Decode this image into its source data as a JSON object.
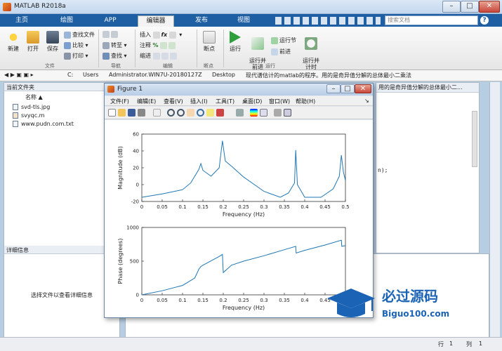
{
  "window": {
    "title": "MATLAB R2018a"
  },
  "ribbon_tabs": [
    "主页",
    "绘图",
    "APP",
    "编辑器",
    "发布",
    "视图"
  ],
  "search_placeholder": "搜索文档",
  "ribbon": {
    "new": "新建",
    "open": "打开",
    "save": "保存",
    "find_files": "查找文件",
    "compare": "比较",
    "print": "打印",
    "goto": "转至",
    "find": "查找",
    "insert": "插入",
    "comment": "注释",
    "indent": "缩进",
    "breakpoints": "断点",
    "run": "运行",
    "run_advance": "运行并\n前进",
    "run_section": "运行节",
    "advance": "前进",
    "run_time": "运行并\n计时",
    "groups": [
      "文件",
      "导航",
      "编辑",
      "断点",
      "运行"
    ]
  },
  "address": {
    "path": [
      "C:",
      "Users",
      "Administrator.WIN7U-20180127Z",
      "Desktop",
      "现代谱估计的matlab的程序。用的是奇异值分解的总体最小二乘法"
    ]
  },
  "current_folder": {
    "title": "当前文件夹",
    "name_col": "名称 ▲",
    "files": [
      "svd-tls.jpg",
      "svyqc.m",
      "www.pudn.com.txt"
    ]
  },
  "details": {
    "title": "详细信息",
    "hint": "选择文件以查看详细信息"
  },
  "editor_tab": "用的是奇异值分解的总体最小二...",
  "editor_line": "n);",
  "status": {
    "row_label": "行",
    "row": "1",
    "col_label": "列",
    "col": "1"
  },
  "figure": {
    "title": "Figure 1",
    "menu": [
      "文件(F)",
      "编辑(E)",
      "查看(V)",
      "插入(I)",
      "工具(T)",
      "桌面(D)",
      "窗口(W)",
      "帮助(H)"
    ]
  },
  "chart_data": [
    {
      "type": "line",
      "xlabel": "Frequency (Hz)",
      "ylabel": "Magnitude (dB)",
      "xlim": [
        0,
        0.5
      ],
      "ylim": [
        -20,
        60
      ],
      "xticks": [
        "0",
        "0.05",
        "0.1",
        "0.15",
        "0.2",
        "0.25",
        "0.3",
        "0.35",
        "0.4",
        "0.45",
        "0.5"
      ],
      "yticks": [
        "-20",
        "0",
        "20",
        "40",
        "60"
      ],
      "x": [
        0,
        0.05,
        0.1,
        0.12,
        0.14,
        0.145,
        0.15,
        0.17,
        0.19,
        0.198,
        0.205,
        0.22,
        0.25,
        0.3,
        0.34,
        0.36,
        0.375,
        0.378,
        0.382,
        0.4,
        0.44,
        0.47,
        0.485,
        0.49,
        0.495,
        0.5
      ],
      "y": [
        -15,
        -11,
        -6,
        2,
        18,
        25,
        17,
        10,
        20,
        52,
        28,
        22,
        9,
        -8,
        -15,
        -10,
        2,
        41,
        0,
        -15,
        -15,
        -5,
        10,
        35,
        15,
        5
      ],
      "color": "#1f77b4"
    },
    {
      "type": "line",
      "xlabel": "Frequency (Hz)",
      "ylabel": "Phase (degrees)",
      "xlim": [
        0,
        0.5
      ],
      "ylim": [
        0,
        1000
      ],
      "xticks": [
        "0",
        "0.05",
        "0.1",
        "0.15",
        "0.2",
        "0.25",
        "0.3",
        "0.35",
        "0.4",
        "0.45"
      ],
      "yticks": [
        "0",
        "500",
        "1000"
      ],
      "x": [
        0,
        0.05,
        0.1,
        0.13,
        0.14,
        0.145,
        0.15,
        0.19,
        0.198,
        0.2,
        0.22,
        0.25,
        0.3,
        0.35,
        0.378,
        0.379,
        0.4,
        0.45,
        0.49,
        0.491,
        0.5
      ],
      "y": [
        0,
        60,
        140,
        250,
        380,
        420,
        440,
        570,
        600,
        330,
        440,
        500,
        580,
        670,
        720,
        620,
        660,
        740,
        810,
        720,
        730
      ],
      "color": "#1f77b4"
    }
  ]
}
